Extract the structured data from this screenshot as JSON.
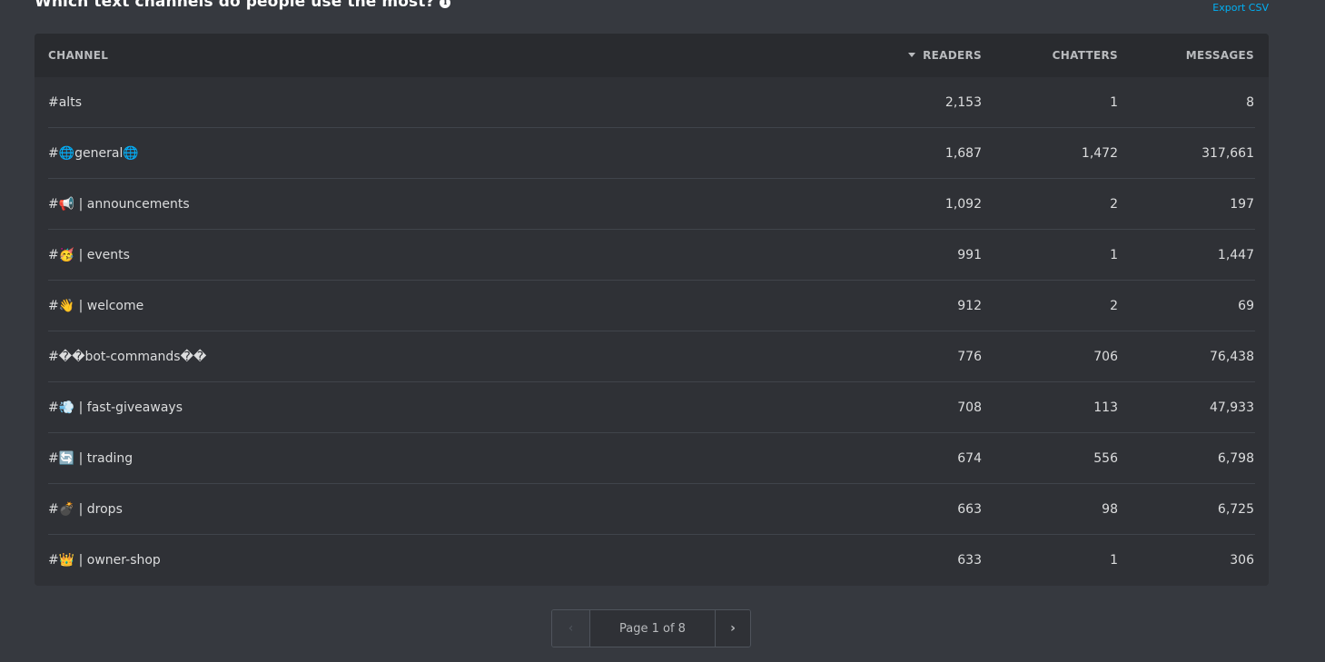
{
  "header": {
    "title": "Which text channels do people use the most?",
    "info_icon": "i",
    "export_label": "Export CSV"
  },
  "table": {
    "columns": {
      "channel": "CHANNEL",
      "readers": "READERS",
      "chatters": "CHATTERS",
      "messages": "MESSAGES"
    },
    "sorted_by": "readers",
    "sort_direction": "descending",
    "rows": [
      {
        "channel": "#alts",
        "readers": "2,153",
        "chatters": "1",
        "messages": "8"
      },
      {
        "channel": "#🌐general🌐",
        "readers": "1,687",
        "chatters": "1,472",
        "messages": "317,661"
      },
      {
        "channel": "#📢 | announcements",
        "readers": "1,092",
        "chatters": "2",
        "messages": "197"
      },
      {
        "channel": "#🥳 | events",
        "readers": "991",
        "chatters": "1",
        "messages": "1,447"
      },
      {
        "channel": "#👋 | welcome",
        "readers": "912",
        "chatters": "2",
        "messages": "69"
      },
      {
        "channel": "#��bot-commands��",
        "readers": "776",
        "chatters": "706",
        "messages": "76,438"
      },
      {
        "channel": "#💨 | fast-giveaways",
        "readers": "708",
        "chatters": "113",
        "messages": "47,933"
      },
      {
        "channel": "#🔄 | trading",
        "readers": "674",
        "chatters": "556",
        "messages": "6,798"
      },
      {
        "channel": "#💣 | drops",
        "readers": "663",
        "chatters": "98",
        "messages": "6,725"
      },
      {
        "channel": "#👑 | owner-shop",
        "readers": "633",
        "chatters": "1",
        "messages": "306"
      }
    ]
  },
  "pagination": {
    "prev_icon": "‹",
    "label": "Page 1 of 8",
    "next_icon": "›",
    "current_page": 1,
    "total_pages": 8
  }
}
